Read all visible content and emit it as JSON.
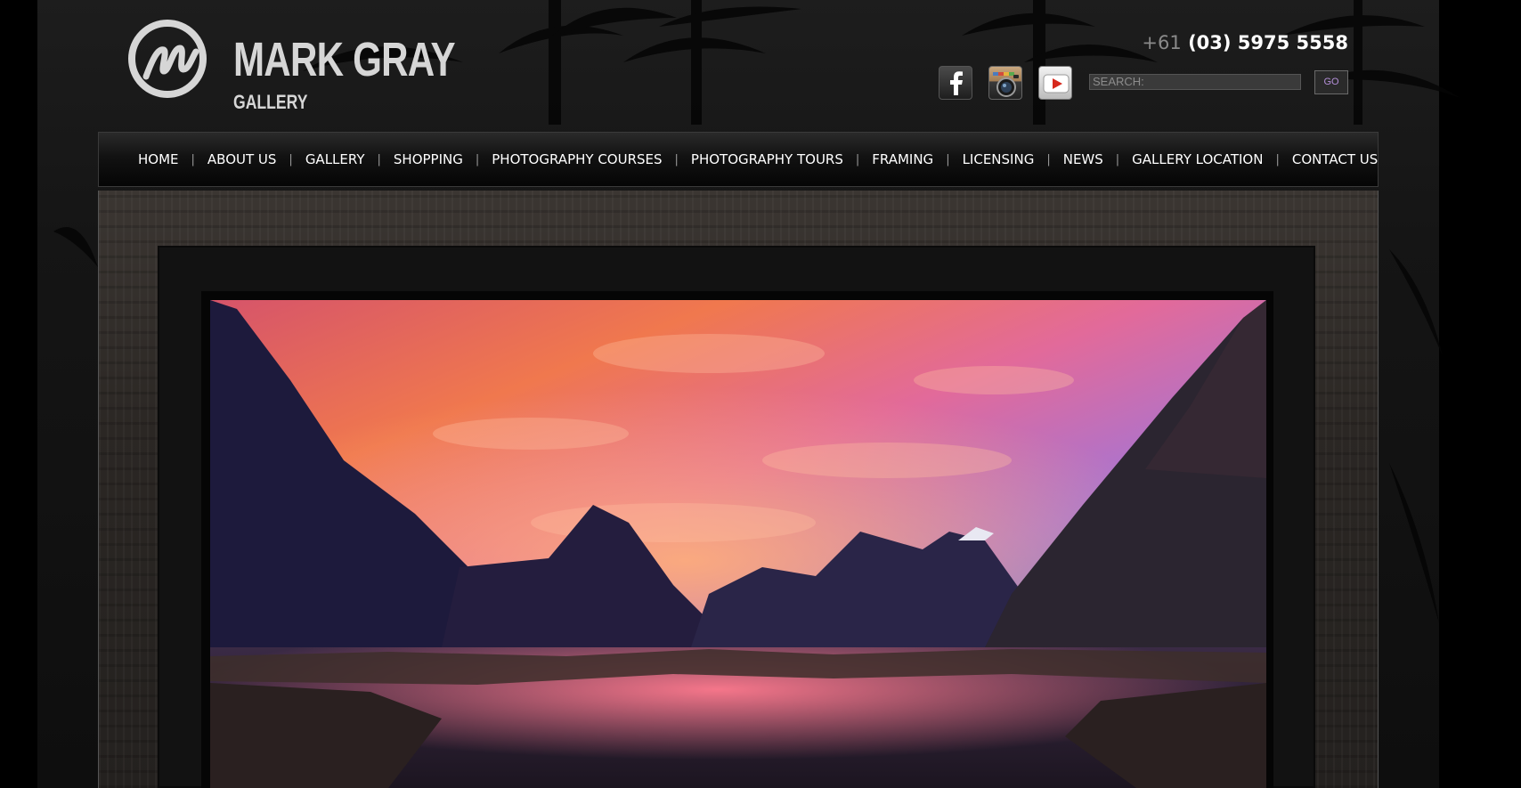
{
  "header": {
    "logo_name": "MARK GRAY",
    "logo_sub": "GALLERY",
    "phone_prefix": "+61",
    "phone_number": "(03) 5975 5558"
  },
  "social": {
    "facebook": "facebook-icon",
    "instagram": "instagram-icon",
    "youtube": "youtube-icon"
  },
  "search": {
    "label": "SEARCH:",
    "value": "",
    "go_label": "GO"
  },
  "nav": {
    "items": [
      "HOME",
      "ABOUT US",
      "GALLERY",
      "SHOPPING",
      "PHOTOGRAPHY COURSES",
      "PHOTOGRAPHY TOURS",
      "FRAMING",
      "LICENSING",
      "NEWS",
      "GALLERY LOCATION",
      "CONTACT US"
    ],
    "separator": "|"
  },
  "colors": {
    "background": "#000000",
    "text": "#ffffff",
    "muted": "#8a8a8a",
    "go_text": "#b48fd8"
  }
}
